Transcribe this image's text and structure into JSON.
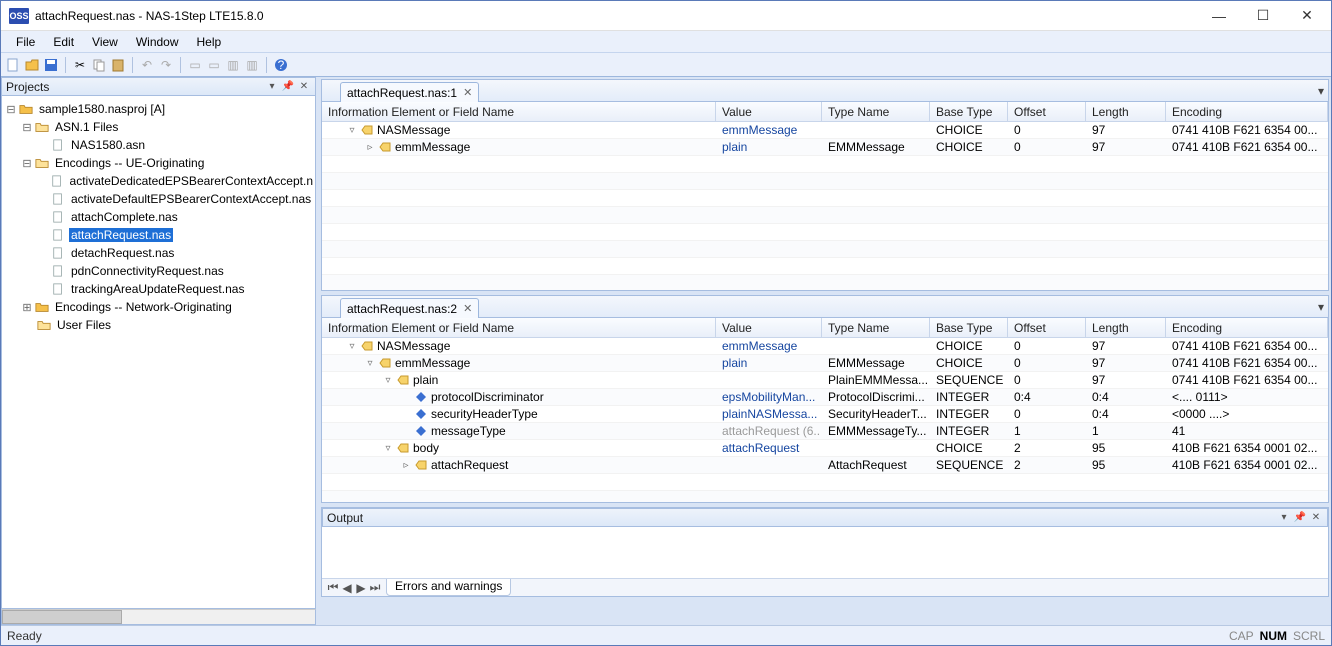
{
  "window": {
    "title": "attachRequest.nas - NAS-1Step LTE15.8.0",
    "appicon": "OSS"
  },
  "menu": [
    "File",
    "Edit",
    "View",
    "Window",
    "Help"
  ],
  "projects": {
    "title": "Projects",
    "root": "sample1580.nasproj [A]",
    "asn_folder": "ASN.1 Files",
    "asn_file": "NAS1580.asn",
    "enc_ue": "Encodings -- UE-Originating",
    "ue_files": [
      "activateDedicatedEPSBearerContextAccept.n",
      "activateDefaultEPSBearerContextAccept.nas",
      "attachComplete.nas",
      "attachRequest.nas",
      "detachRequest.nas",
      "pdnConnectivityRequest.nas",
      "trackingAreaUpdateRequest.nas"
    ],
    "enc_net": "Encodings -- Network-Originating",
    "user_files": "User Files"
  },
  "tabs": {
    "top": "attachRequest.nas:1",
    "mid": "attachRequest.nas:2"
  },
  "cols": [
    "Information Element or Field Name",
    "Value",
    "Type Name",
    "Base Type",
    "Offset",
    "Length",
    "Encoding"
  ],
  "top_rows": [
    {
      "indent": 1,
      "exp": "▿",
      "icon": "struct",
      "name": "NASMessage",
      "value": "emmMessage",
      "vcls": "valblue",
      "type": "",
      "base": "CHOICE",
      "off": "0",
      "len": "97",
      "enc": "0741 410B F621 6354 00..."
    },
    {
      "indent": 2,
      "exp": "▹",
      "icon": "struct",
      "name": "emmMessage",
      "value": "plain",
      "vcls": "valblue",
      "type": "EMMMessage",
      "base": "CHOICE",
      "off": "0",
      "len": "97",
      "enc": "0741 410B F621 6354 00..."
    }
  ],
  "mid_rows": [
    {
      "indent": 1,
      "exp": "▿",
      "icon": "struct",
      "name": "NASMessage",
      "value": "emmMessage",
      "vcls": "valblue",
      "type": "",
      "base": "CHOICE",
      "off": "0",
      "len": "97",
      "enc": "0741 410B F621 6354 00..."
    },
    {
      "indent": 2,
      "exp": "▿",
      "icon": "struct",
      "name": "emmMessage",
      "value": "plain",
      "vcls": "valblue",
      "type": "EMMMessage",
      "base": "CHOICE",
      "off": "0",
      "len": "97",
      "enc": "0741 410B F621 6354 00..."
    },
    {
      "indent": 3,
      "exp": "▿",
      "icon": "struct",
      "name": "plain",
      "value": "",
      "vcls": "",
      "type": "PlainEMMMessa...",
      "base": "SEQUENCE",
      "off": "0",
      "len": "97",
      "enc": "0741 410B F621 6354 00..."
    },
    {
      "indent": 4,
      "exp": "",
      "icon": "field",
      "name": "protocolDiscriminator",
      "value": "epsMobilityMan...",
      "vcls": "valblue",
      "type": "ProtocolDiscrimi...",
      "base": "INTEGER",
      "off": "0:4",
      "len": "0:4",
      "enc": "<.... 0111>"
    },
    {
      "indent": 4,
      "exp": "",
      "icon": "field",
      "name": "securityHeaderType",
      "value": "plainNASMessa...",
      "vcls": "valblue",
      "type": "SecurityHeaderT...",
      "base": "INTEGER",
      "off": "0",
      "len": "0:4",
      "enc": "<0000 ....>"
    },
    {
      "indent": 4,
      "exp": "",
      "icon": "field",
      "name": "messageType",
      "value": "attachRequest (6...",
      "vcls": "valgray",
      "type": "EMMMessageTy...",
      "base": "INTEGER",
      "off": "1",
      "len": "1",
      "enc": "41"
    },
    {
      "indent": 3,
      "exp": "▿",
      "icon": "struct",
      "name": "body",
      "value": "attachRequest",
      "vcls": "valblue",
      "type": "",
      "base": "CHOICE",
      "off": "2",
      "len": "95",
      "enc": "410B F621 6354 0001 02..."
    },
    {
      "indent": 4,
      "exp": "▹",
      "icon": "struct",
      "name": "attachRequest",
      "value": "",
      "vcls": "",
      "type": "AttachRequest",
      "base": "SEQUENCE",
      "off": "2",
      "len": "95",
      "enc": "410B F621 6354 0001 02..."
    }
  ],
  "output": {
    "title": "Output",
    "tab": "Errors and warnings"
  },
  "status": {
    "ready": "Ready",
    "cap": "CAP",
    "num": "NUM",
    "scrl": "SCRL"
  }
}
